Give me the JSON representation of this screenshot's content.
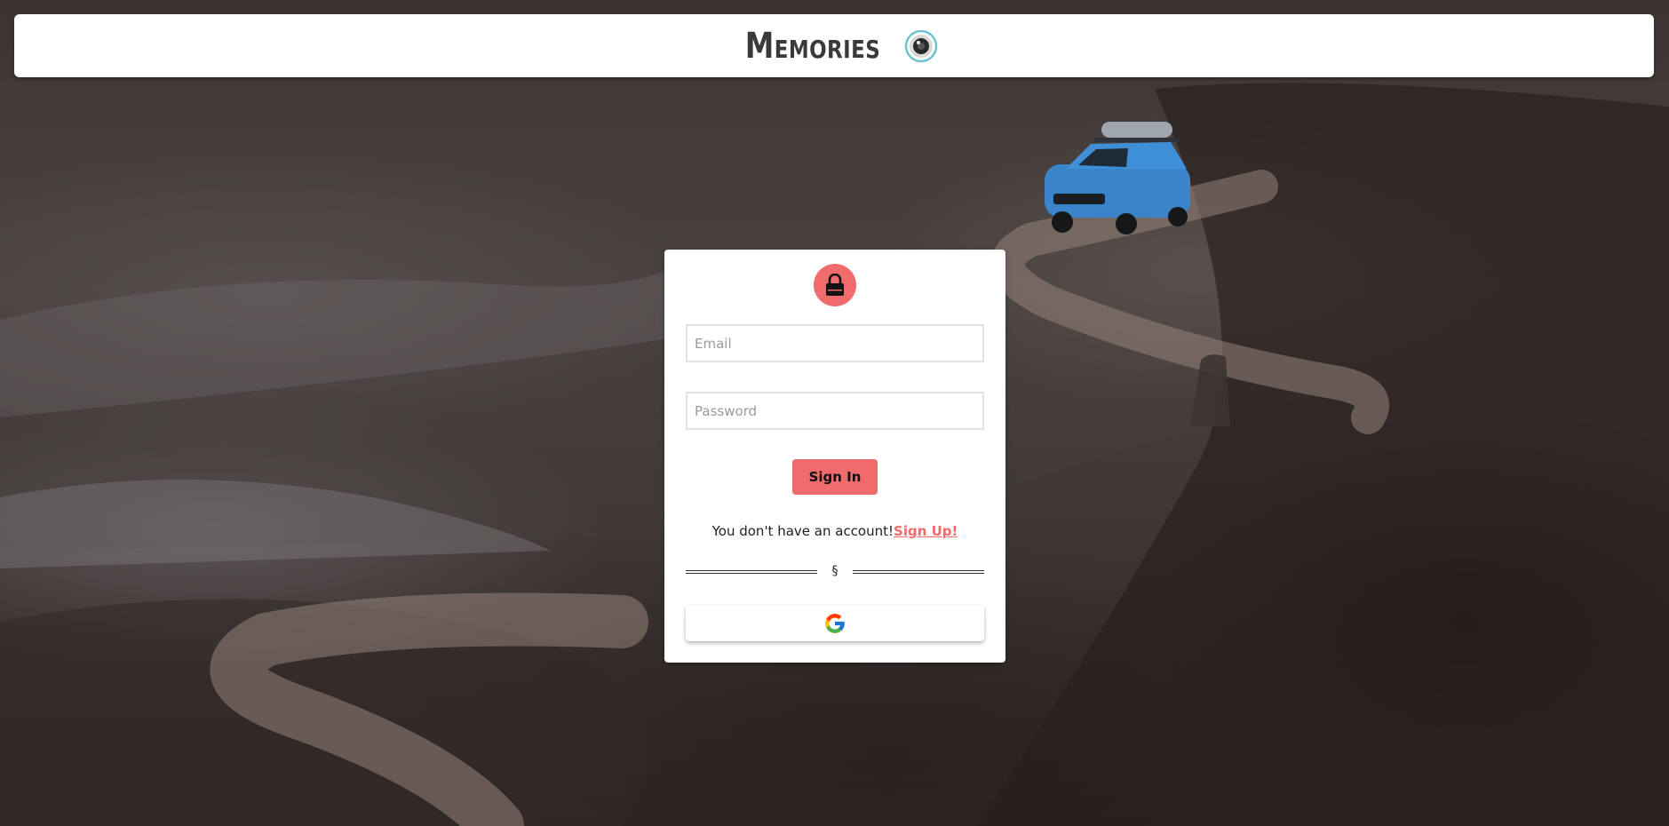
{
  "header": {
    "brand_title": "Memories",
    "logo_icon": "camera-lens-icon"
  },
  "login": {
    "avatar_icon": "lock-icon",
    "email_placeholder": "Email",
    "password_placeholder": "Password",
    "signin_label": "Sign In",
    "signup_prompt": "You don't have an account!",
    "signup_link": "Sign Up!",
    "divider_mark": "§",
    "google_icon": "google-icon"
  },
  "colors": {
    "accent": "#f06b6b",
    "header_bg": "#ffffff",
    "card_bg": "#ffffff"
  }
}
